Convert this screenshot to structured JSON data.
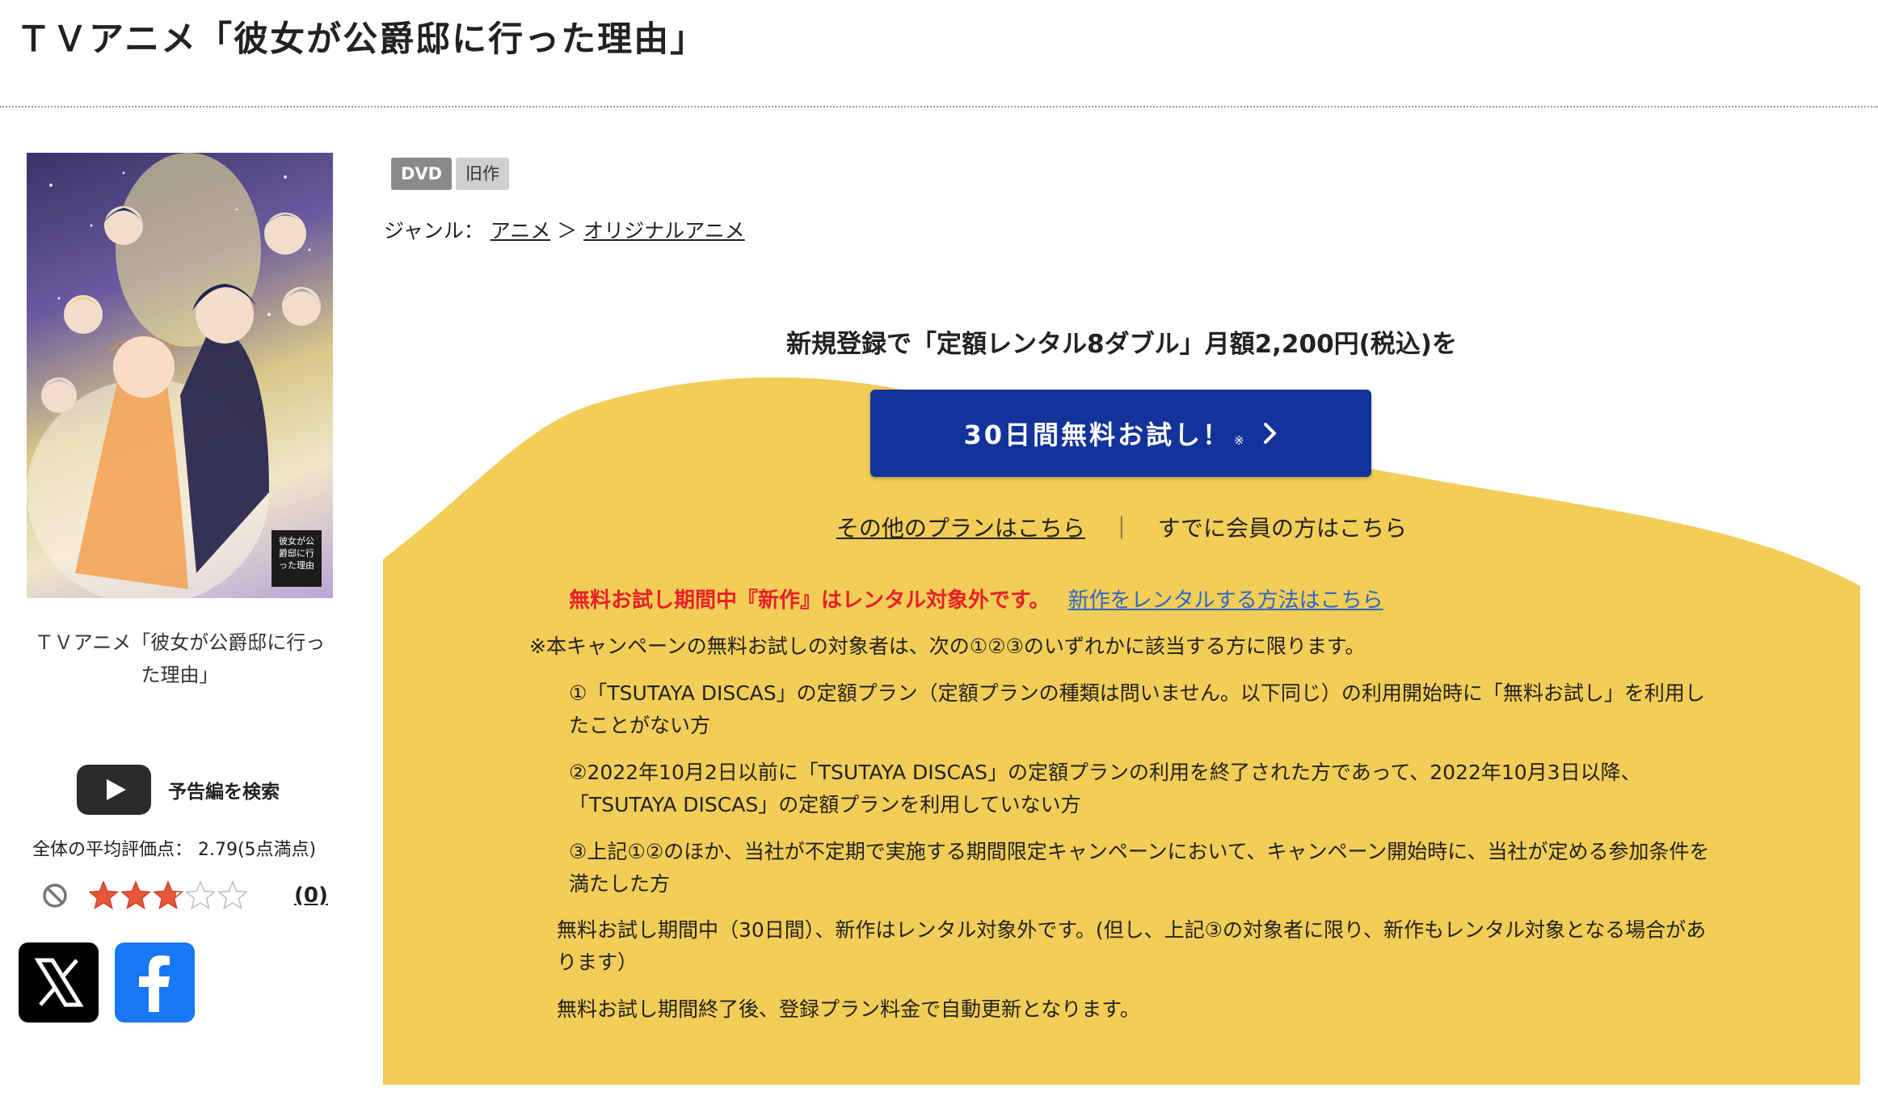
{
  "page": {
    "title": "ＴＶアニメ「彼女が公爵邸に行った理由」"
  },
  "sidebar": {
    "cover_logo_text": "彼女が公爵邸に行った理由",
    "caption": "ＴＶアニメ「彼女が公爵邸に行った理由」",
    "trailer_label": "予告編を検索",
    "rating_label": "全体の平均評価点： 2.79(5点満点)",
    "rating_value": 2.79,
    "rating_max": 5,
    "review_count": "(0)",
    "icons": {
      "trailer": "youtube-play-icon",
      "no_review": "prohibited-icon",
      "x": "x-logo-icon",
      "facebook": "facebook-logo-icon"
    }
  },
  "product": {
    "tags": [
      "DVD",
      "旧作"
    ],
    "genre_label": "ジャンル：",
    "genre_items": [
      "アニメ",
      "オリジナルアニメ"
    ],
    "genre_separator": "＞"
  },
  "promo": {
    "heading": "新規登録で「定額レンタル8ダブル」月額2,200円(税込)を",
    "cta_label": "30日間無料お試し！",
    "cta_note": "※",
    "other_plans_link": "その他のプランはこちら",
    "separator": "｜",
    "member_link": "すでに会員の方はこちら",
    "notice_red": "無料お試し期間中『新作』はレンタル対象外です。",
    "notice_link": "新作をレンタルする方法はこちら",
    "terms_intro": "※本キャンペーンの無料お試しの対象者は、次の①②③のいずれかに該当する方に限ります。",
    "conditions": [
      "①「TSUTAYA DISCAS」の定額プラン（定額プランの種類は問いません。以下同じ）の利用開始時に「無料お試し」を利用したことがない方",
      "②2022年10月2日以前に「TSUTAYA DISCAS」の定額プランの利用を終了された方であって、2022年10月3日以降、「TSUTAYA DISCAS」の定額プランを利用していない方",
      "③上記①②のほか、当社が不定期で実施する期間限定キャンペーンにおいて、キャンペーン開始時に、当社が定める参加条件を満たした方"
    ],
    "paragraphs": [
      "無料お試し期間中（30日間）、新作はレンタル対象外です。(但し、上記③の対象者に限り、新作もレンタル対象となる場合があります）",
      "無料お試し期間終了後、登録プラン料金で自動更新となります。"
    ]
  },
  "colors": {
    "yellow_panel": "#f2cd57",
    "cta_blue": "#13329a",
    "notice_red": "#e8202a",
    "link_blue": "#2f67c7",
    "star_fill": "#e8553a"
  }
}
